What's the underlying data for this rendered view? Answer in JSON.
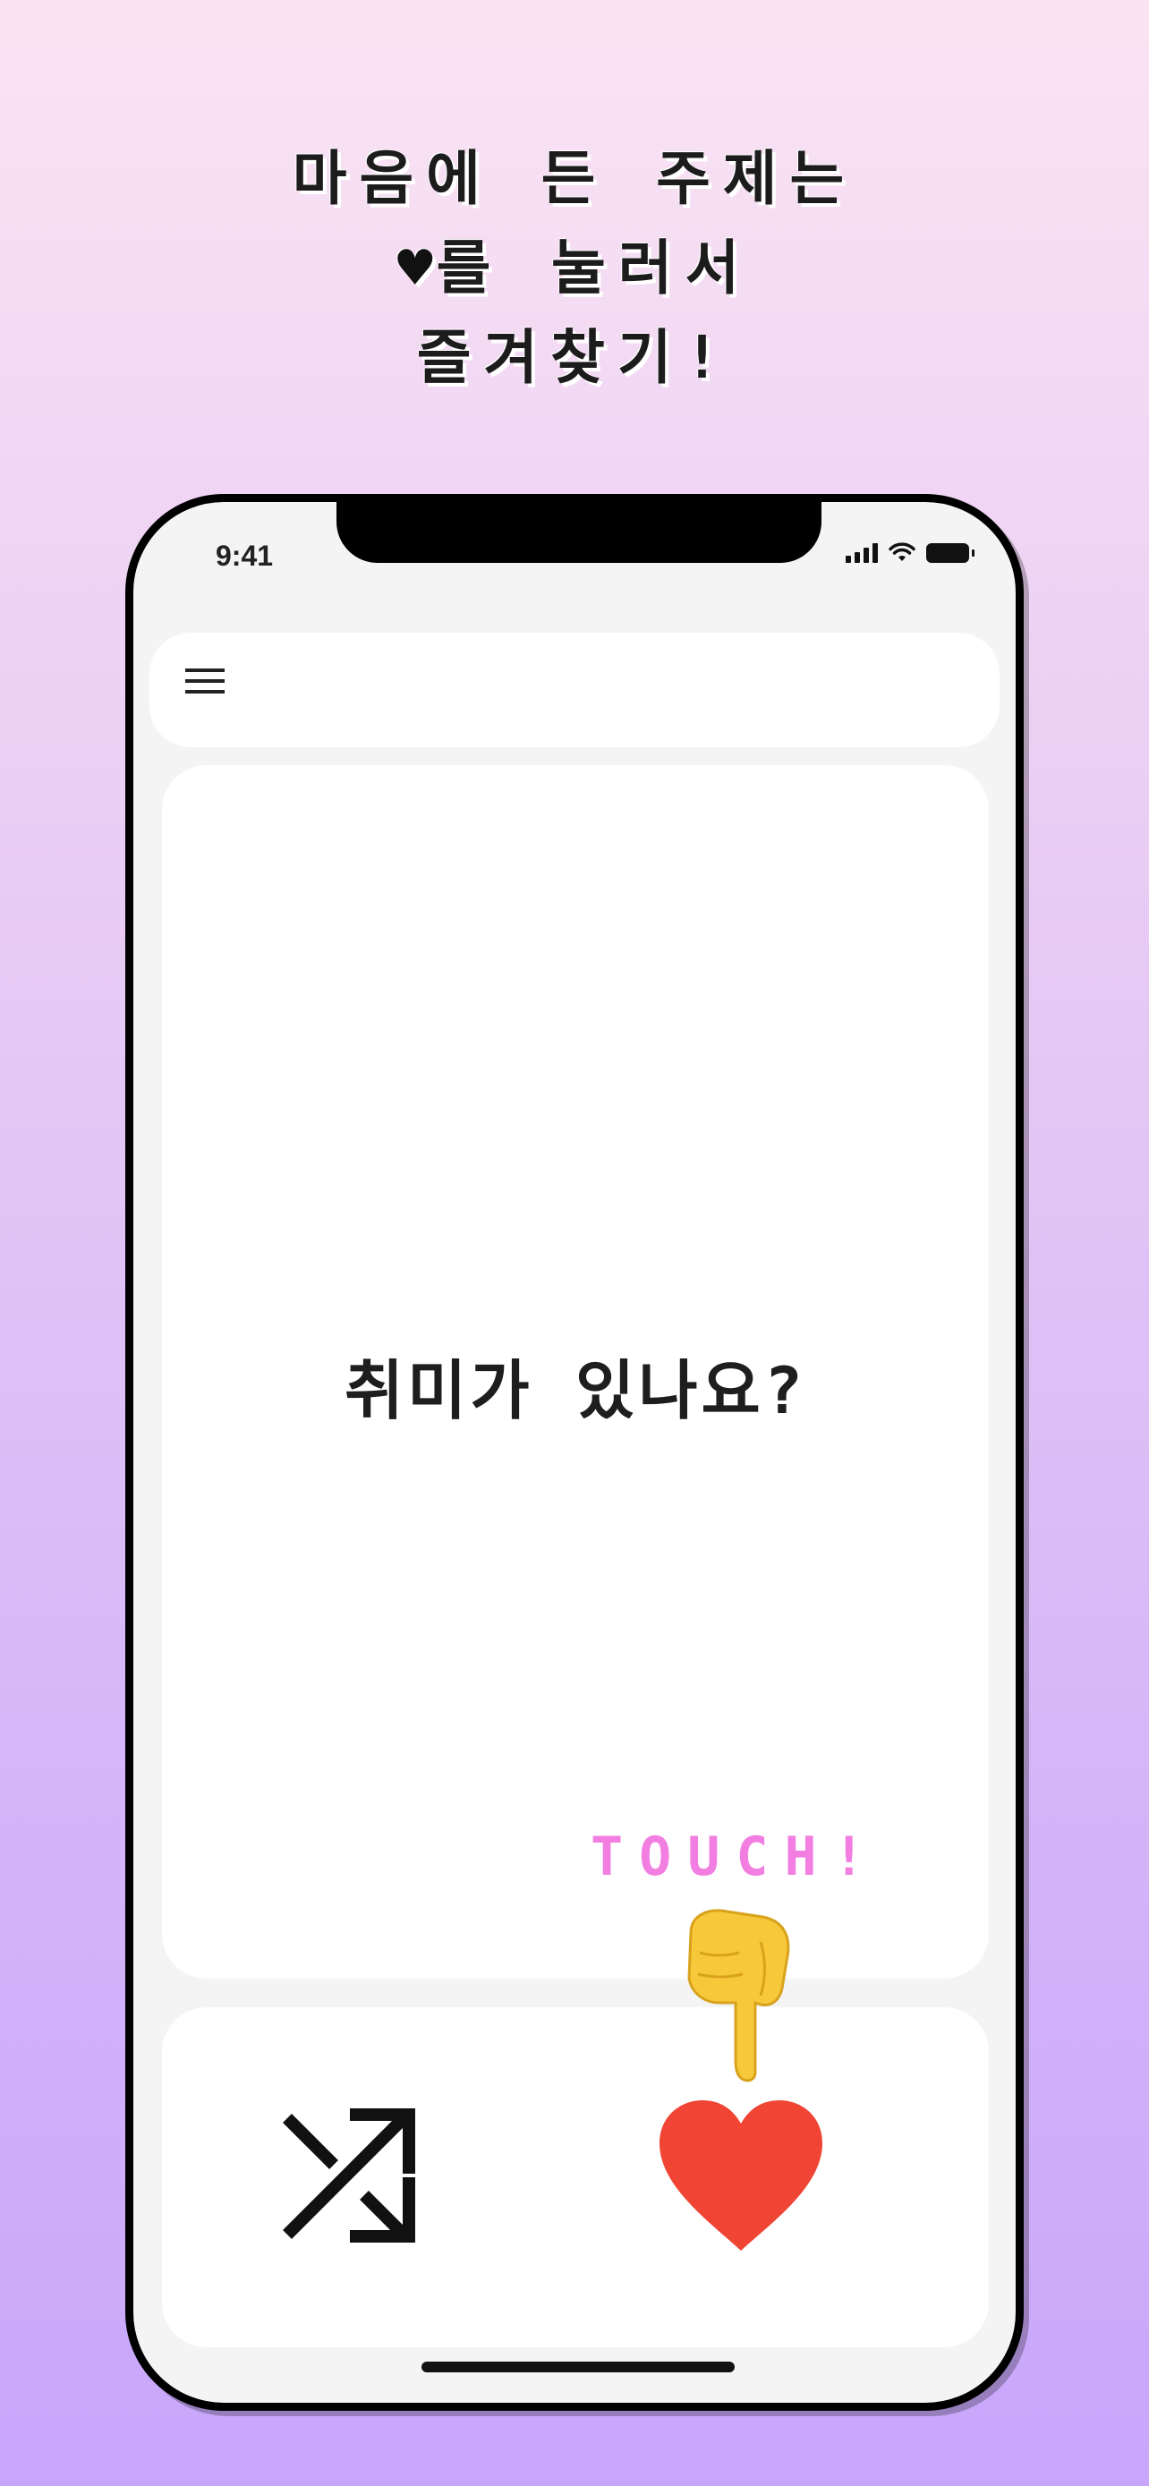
{
  "promo": {
    "line1": "마음에 든 주제는",
    "line2_heart": "♥",
    "line2": "를 눌러서",
    "line3": "즐겨찾기!"
  },
  "status_bar": {
    "time": "9:41"
  },
  "card": {
    "question": "취미가 있나요?"
  },
  "hint": {
    "touch_text": "TOUCH!"
  },
  "icons": {
    "menu": "hamburger-menu-icon",
    "shuffle": "shuffle-icon",
    "favorite": "heart-icon",
    "pointer": "pointing-down-hand-icon"
  },
  "colors": {
    "heart": "#f04434",
    "touch_text": "#f17ee0",
    "hand": "#f7c83a"
  }
}
